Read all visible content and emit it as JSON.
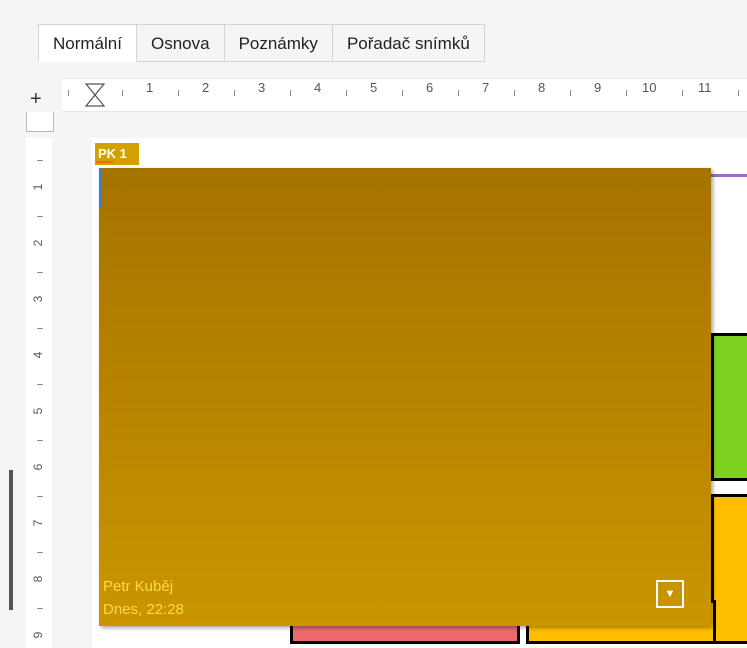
{
  "tabs": [
    {
      "label": "Normální",
      "active": true
    },
    {
      "label": "Osnova",
      "active": false
    },
    {
      "label": "Poznámky",
      "active": false
    },
    {
      "label": "Pořadač snímků",
      "active": false
    }
  ],
  "hruler": {
    "numbers": [
      "1",
      "2",
      "3",
      "4",
      "5",
      "6",
      "7",
      "8",
      "9",
      "10",
      "11"
    ]
  },
  "vruler": {
    "numbers": [
      "1",
      "2",
      "3",
      "4",
      "5",
      "6",
      "7",
      "8",
      "9"
    ]
  },
  "comment": {
    "marker": "PK 1",
    "author": "Petr Kuběj",
    "date": "Dnes, 22:28",
    "menu_icon": "chevron-down-icon",
    "color": "#c9a000"
  },
  "colors": {
    "green": "#7ed321",
    "yellow": "#ffbf00",
    "red": "#ec6a6a",
    "purple": "#9a6bc6"
  }
}
